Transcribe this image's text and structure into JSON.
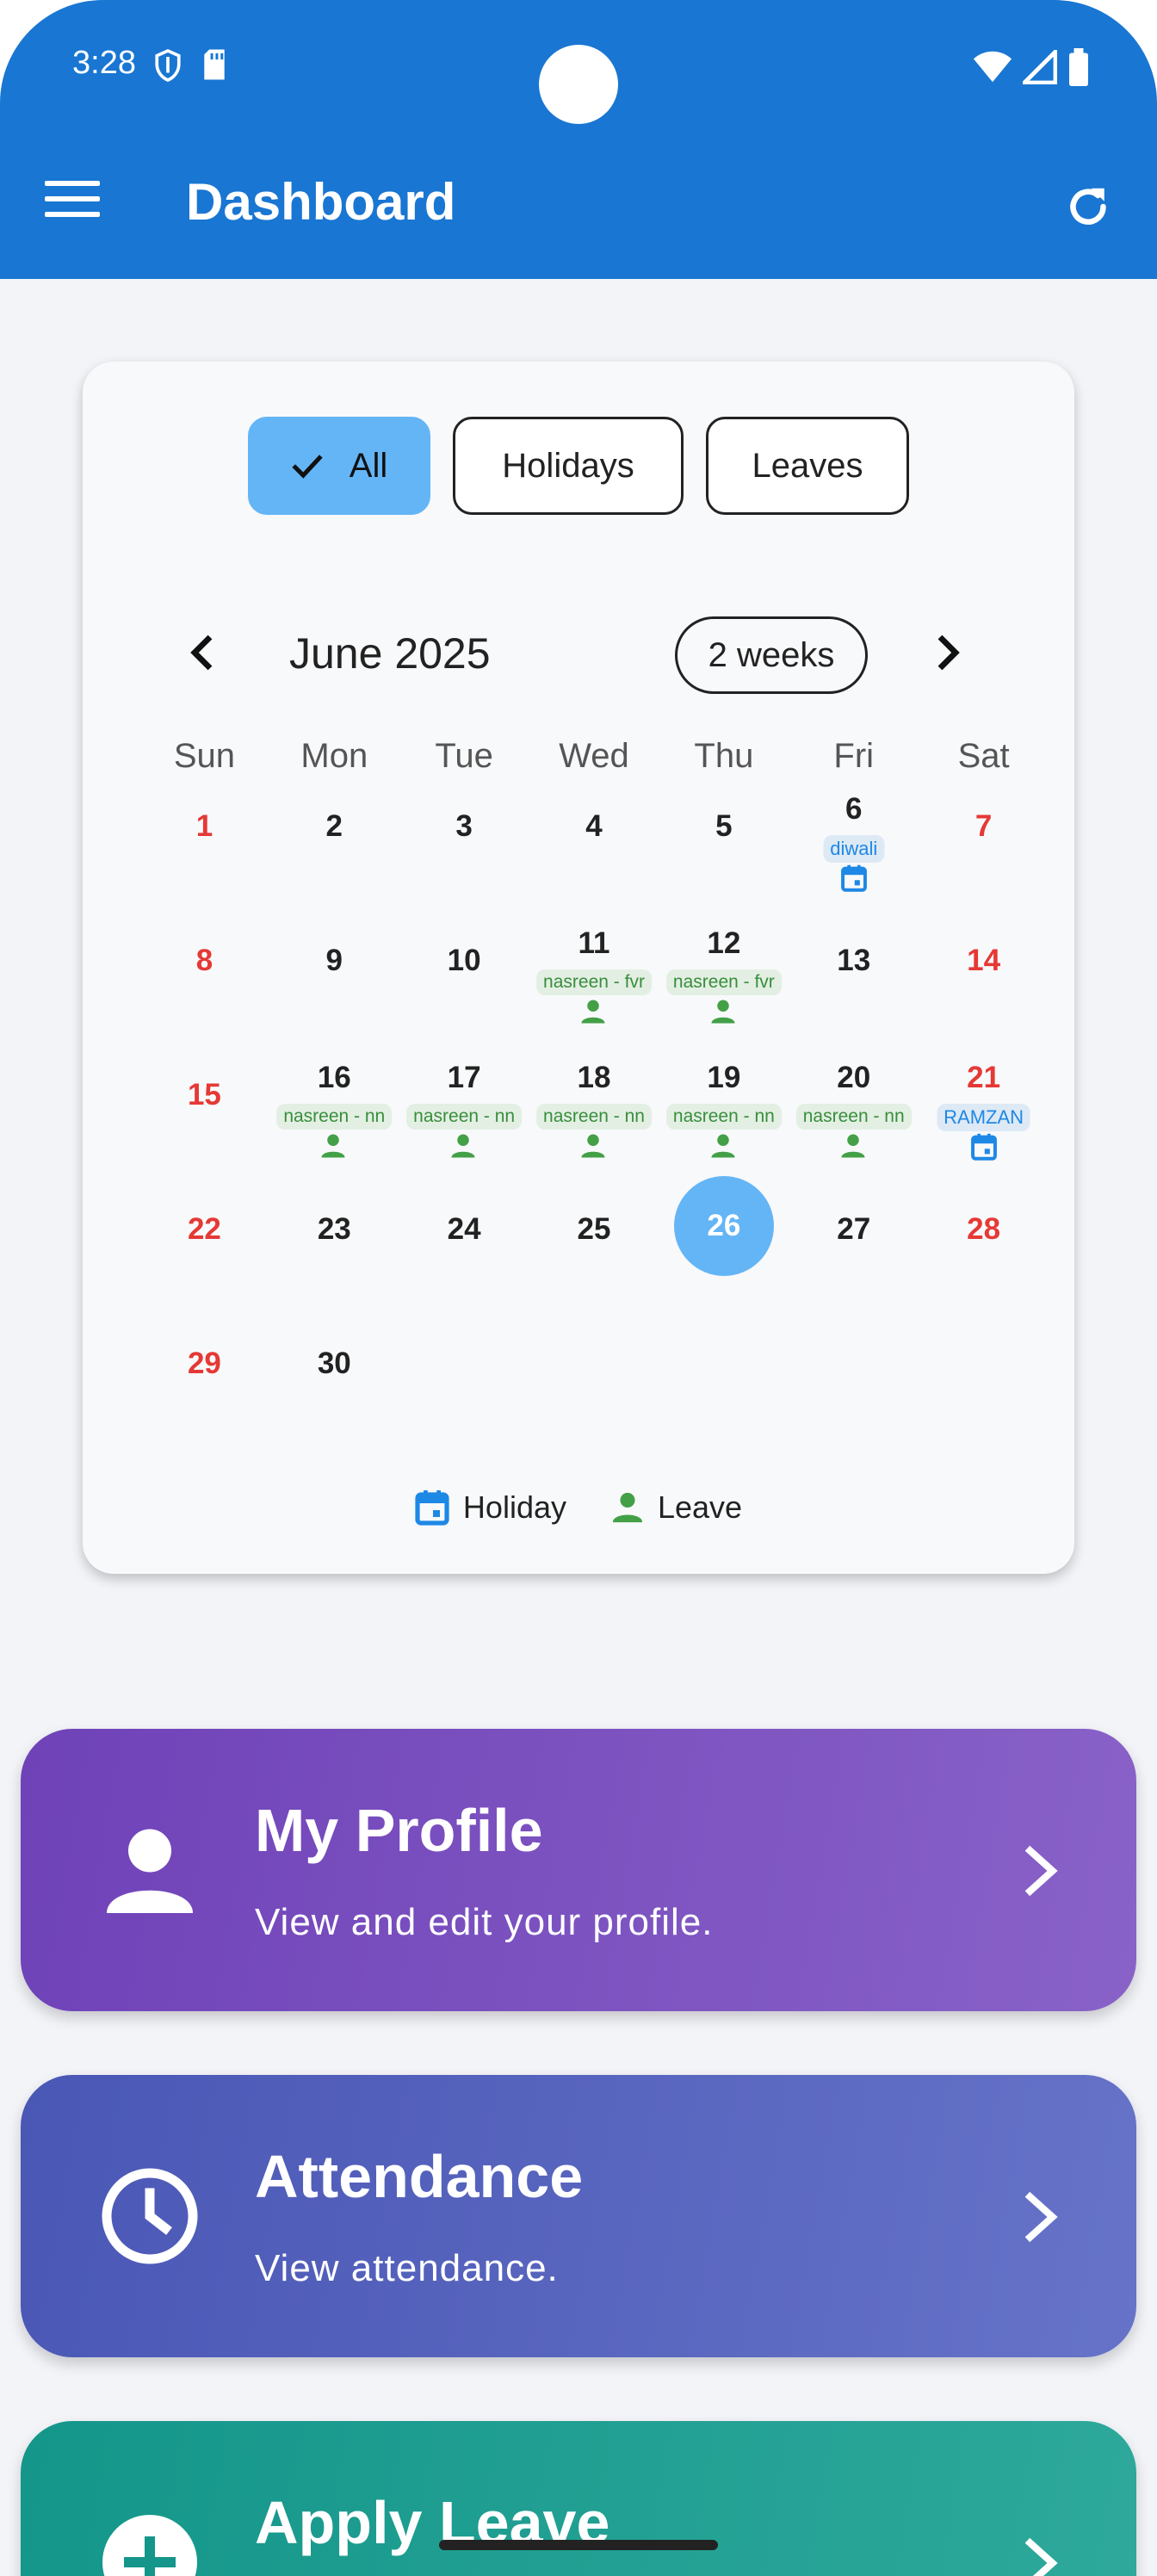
{
  "status_bar": {
    "time": "3:28"
  },
  "app_bar": {
    "title": "Dashboard"
  },
  "filters": [
    {
      "label": "All",
      "selected": true
    },
    {
      "label": "Holidays",
      "selected": false
    },
    {
      "label": "Leaves",
      "selected": false
    }
  ],
  "calendar": {
    "month_label": "June 2025",
    "format_label": "2 weeks",
    "weekdays": [
      "Sun",
      "Mon",
      "Tue",
      "Wed",
      "Thu",
      "Fri",
      "Sat"
    ],
    "today": "26",
    "weeks": [
      [
        {
          "day": "1",
          "weekend": true
        },
        {
          "day": "2"
        },
        {
          "day": "3"
        },
        {
          "day": "4"
        },
        {
          "day": "5"
        },
        {
          "day": "6",
          "event": "diwali",
          "type": "holiday"
        },
        {
          "day": "7",
          "weekend": true
        }
      ],
      [
        {
          "day": "8",
          "weekend": true
        },
        {
          "day": "9"
        },
        {
          "day": "10"
        },
        {
          "day": "11",
          "event": "nasreen - fvr",
          "type": "leave"
        },
        {
          "day": "12",
          "event": "nasreen - fvr",
          "type": "leave"
        },
        {
          "day": "13"
        },
        {
          "day": "14",
          "weekend": true
        }
      ],
      [
        {
          "day": "15",
          "weekend": true
        },
        {
          "day": "16",
          "event": "nasreen - nn",
          "type": "leave"
        },
        {
          "day": "17",
          "event": "nasreen - nn",
          "type": "leave"
        },
        {
          "day": "18",
          "event": "nasreen - nn",
          "type": "leave"
        },
        {
          "day": "19",
          "event": "nasreen - nn",
          "type": "leave"
        },
        {
          "day": "20",
          "event": "nasreen - nn",
          "type": "leave"
        },
        {
          "day": "21",
          "weekend": true,
          "event": "RAMZAN",
          "type": "holiday"
        }
      ],
      [
        {
          "day": "22",
          "weekend": true
        },
        {
          "day": "23"
        },
        {
          "day": "24"
        },
        {
          "day": "25"
        },
        {
          "day": "26",
          "today": true
        },
        {
          "day": "27"
        },
        {
          "day": "28",
          "weekend": true
        }
      ],
      [
        {
          "day": "29",
          "weekend": true
        },
        {
          "day": "30"
        }
      ]
    ],
    "legend": {
      "holiday": "Holiday",
      "leave": "Leave"
    }
  },
  "cards": {
    "profile": {
      "title": "My Profile",
      "subtitle": "View and edit your profile."
    },
    "attendance": {
      "title": "Attendance",
      "subtitle": "View attendance."
    },
    "apply": {
      "title": "Apply Leave"
    }
  },
  "colors": {
    "app_bar": "#1976d2",
    "selected_chip": "#64b5f6",
    "weekend": "#e53935",
    "leave": "#388e3c",
    "holiday": "#1e88e5"
  },
  "icons": [
    "shield-icon",
    "sd-card-icon",
    "wifi-icon",
    "signal-icon",
    "battery-icon",
    "menu-icon",
    "refresh-icon",
    "check-icon",
    "chevron-left-icon",
    "chevron-right-icon",
    "calendar-icon",
    "person-icon",
    "clock-icon",
    "plus-circle-icon"
  ]
}
